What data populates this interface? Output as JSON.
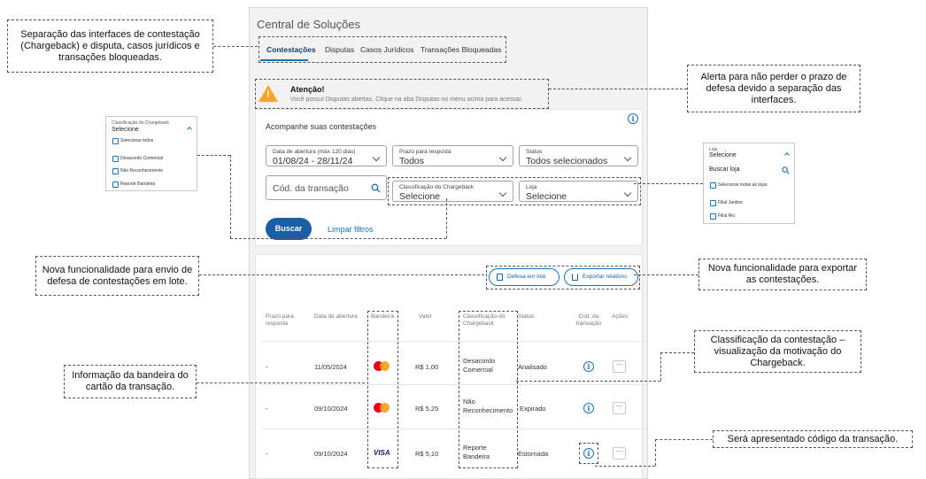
{
  "app": {
    "title": "Central de Soluções",
    "tabs": [
      "Contestações",
      "Disputas",
      "Casos Jurídicos",
      "Transações Bloqueadas"
    ]
  },
  "alert": {
    "title": "Atenção!",
    "text": "Você possui Disputas abertas. Clique na aba Disputas no menu acima para acessar."
  },
  "filters": {
    "heading": "Acompanhe suas contestações",
    "date_label": "Data de abertura (máx 120 dias)",
    "date_value": "01/08/24 - 28/11/24",
    "deadline_label": "Prazo para resposta",
    "deadline_value": "Todos",
    "status_label": "Status",
    "status_value": "Todos selecionados",
    "transaction_placeholder": "Cód. da transação",
    "classification_label": "Classificação do Chargeback",
    "classification_value": "Selecione",
    "store_label": "Loja",
    "store_value": "Selecione",
    "search_button": "Buscar",
    "clear_link": "Limpar filtros"
  },
  "results": {
    "batch_button": "Defesa em lote",
    "export_button": "Exportar relatório",
    "headers": [
      "Prazo para resposta",
      "Data de abertura",
      "Bandeira",
      "Valor",
      "Classificação do Chargeback",
      "Status",
      "Cod. da transação",
      "Ações"
    ],
    "rows": [
      {
        "deadline": "-",
        "date": "11/05/2024",
        "brand": "mastercard",
        "value": "R$ 1,00",
        "classification": "Desacordo Comercial",
        "status": "Analisado"
      },
      {
        "deadline": "-",
        "date": "09/10/2024",
        "brand": "mastercard",
        "value": "R$ 5,25",
        "classification": "Não Reconhecimento",
        "status": "Expirado"
      },
      {
        "deadline": "-",
        "date": "09/10/2024",
        "brand": "visa",
        "brand_text": "VISA",
        "value": "R$ 5,10",
        "classification": "Reporte Bandeira",
        "status": "Estornada"
      }
    ]
  },
  "popup_classification": {
    "label": "Classificação do Chargeback",
    "value": "Selecione",
    "items": [
      "Selecionar todos",
      "Desacordo Comercial",
      "Não Reconhecimento",
      "Reporte Bandeira"
    ]
  },
  "popup_store": {
    "label": "Loja",
    "value": "Selecione",
    "search": "Buscar loja",
    "items": [
      "Selecionar todas as lojas",
      "Filial Jardins",
      "Filial Rio"
    ]
  },
  "callouts": {
    "tabs": "Separação das interfaces de contestação (Chargeback) e disputa, casos jurídicos e transações bloqueadas.",
    "alert": "Alerta para não perder o prazo de defesa devido a separação das interfaces.",
    "batch": "Nova funcionalidade para envio de defesa de contestações em lote.",
    "export": "Nova funcionalidade para exportar as contestações.",
    "classification": "Classificação da contestação – visualização da motivação do Chargeback.",
    "brand": "Informação da bandeira do cartão da transação.",
    "code": "Será apresentado código da transação."
  }
}
